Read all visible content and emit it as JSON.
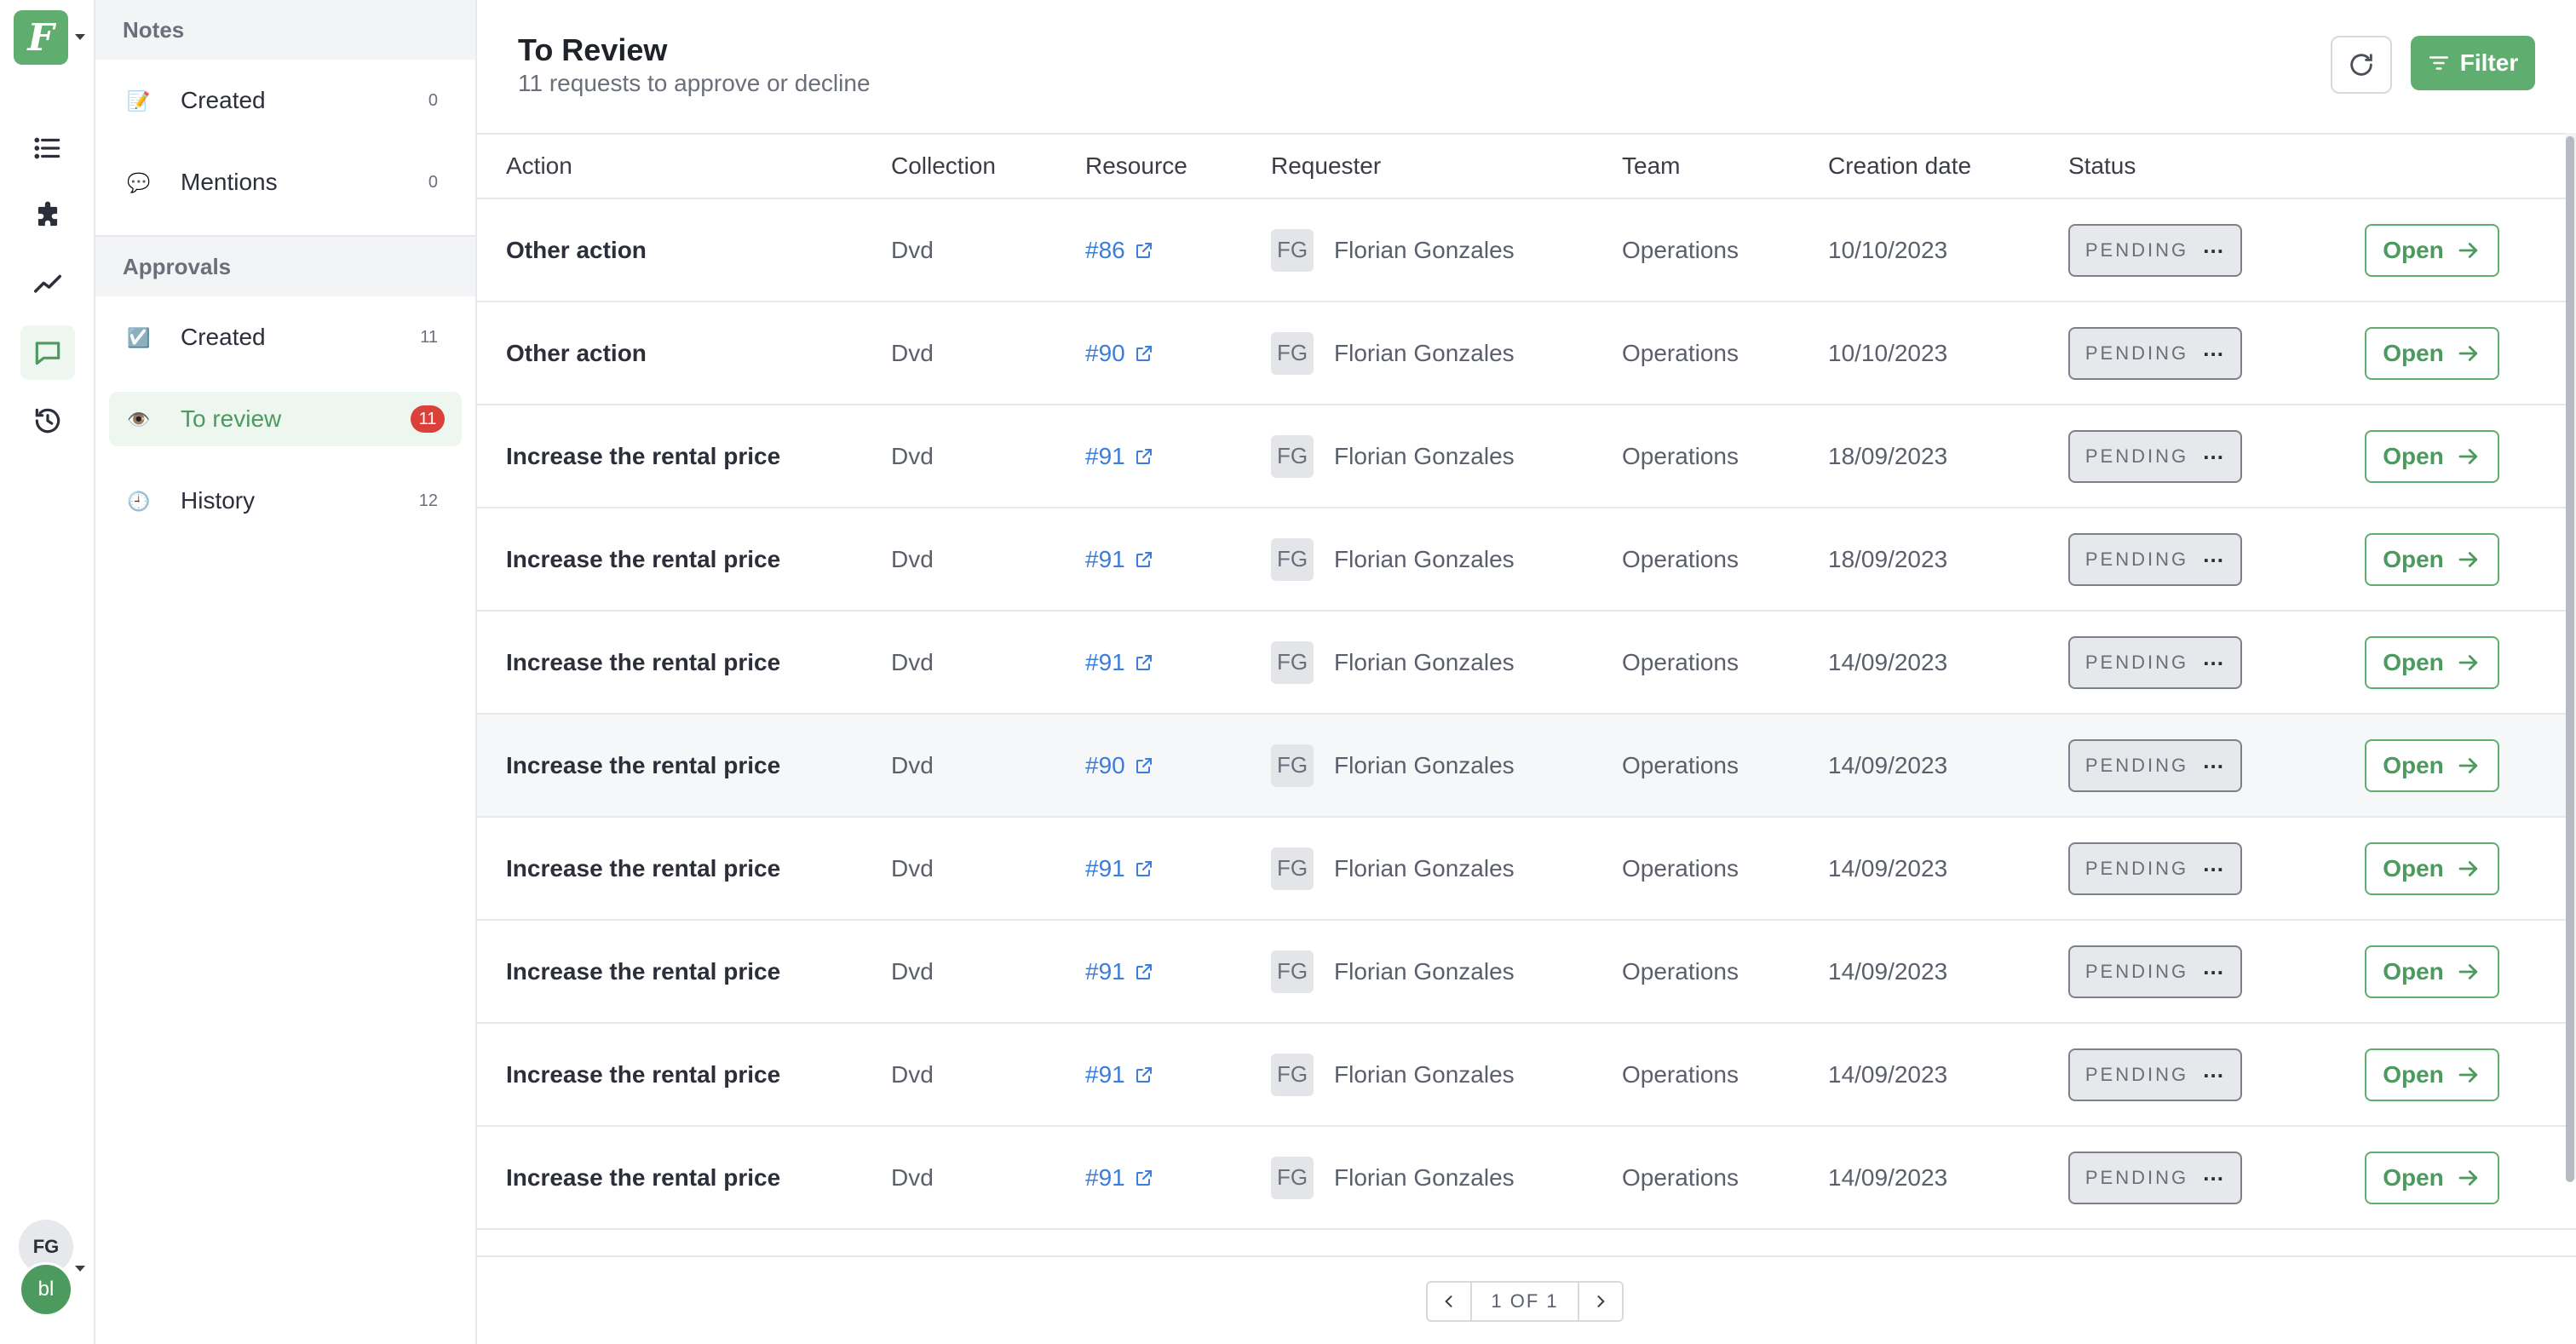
{
  "rail": {
    "logo_letter": "F",
    "avatar_initials": "FG",
    "workspace_initials": "bl",
    "icons": [
      "list-icon",
      "puzzle-icon",
      "chart-line-icon",
      "chat-icon",
      "history-icon"
    ]
  },
  "sidebar": {
    "notes_header": "Notes",
    "notes_items": [
      {
        "label": "Created",
        "count": "0"
      },
      {
        "label": "Mentions",
        "count": "0"
      }
    ],
    "approvals_header": "Approvals",
    "approval_items": [
      {
        "label": "Created",
        "count": "11"
      },
      {
        "label": "To review",
        "count": "11"
      },
      {
        "label": "History",
        "count": "12"
      }
    ]
  },
  "header": {
    "title": "To Review",
    "subtitle": "11 requests to approve or decline",
    "filter_label": "Filter"
  },
  "table": {
    "columns": [
      "Action",
      "Collection",
      "Resource",
      "Requester",
      "Team",
      "Creation date",
      "Status"
    ],
    "rows": [
      {
        "action": "Other action",
        "collection": "Dvd",
        "resource": "#86",
        "initials": "FG",
        "requester": "Florian Gonzales",
        "team": "Operations",
        "date": "10/10/2023",
        "status": "PENDING",
        "open": "Open"
      },
      {
        "action": "Other action",
        "collection": "Dvd",
        "resource": "#90",
        "initials": "FG",
        "requester": "Florian Gonzales",
        "team": "Operations",
        "date": "10/10/2023",
        "status": "PENDING",
        "open": "Open"
      },
      {
        "action": "Increase the rental price",
        "collection": "Dvd",
        "resource": "#91",
        "initials": "FG",
        "requester": "Florian Gonzales",
        "team": "Operations",
        "date": "18/09/2023",
        "status": "PENDING",
        "open": "Open"
      },
      {
        "action": "Increase the rental price",
        "collection": "Dvd",
        "resource": "#91",
        "initials": "FG",
        "requester": "Florian Gonzales",
        "team": "Operations",
        "date": "18/09/2023",
        "status": "PENDING",
        "open": "Open"
      },
      {
        "action": "Increase the rental price",
        "collection": "Dvd",
        "resource": "#91",
        "initials": "FG",
        "requester": "Florian Gonzales",
        "team": "Operations",
        "date": "14/09/2023",
        "status": "PENDING",
        "open": "Open"
      },
      {
        "action": "Increase the rental price",
        "collection": "Dvd",
        "resource": "#90",
        "initials": "FG",
        "requester": "Florian Gonzales",
        "team": "Operations",
        "date": "14/09/2023",
        "status": "PENDING",
        "open": "Open"
      },
      {
        "action": "Increase the rental price",
        "collection": "Dvd",
        "resource": "#91",
        "initials": "FG",
        "requester": "Florian Gonzales",
        "team": "Operations",
        "date": "14/09/2023",
        "status": "PENDING",
        "open": "Open"
      },
      {
        "action": "Increase the rental price",
        "collection": "Dvd",
        "resource": "#91",
        "initials": "FG",
        "requester": "Florian Gonzales",
        "team": "Operations",
        "date": "14/09/2023",
        "status": "PENDING",
        "open": "Open"
      },
      {
        "action": "Increase the rental price",
        "collection": "Dvd",
        "resource": "#91",
        "initials": "FG",
        "requester": "Florian Gonzales",
        "team": "Operations",
        "date": "14/09/2023",
        "status": "PENDING",
        "open": "Open"
      },
      {
        "action": "Increase the rental price",
        "collection": "Dvd",
        "resource": "#91",
        "initials": "FG",
        "requester": "Florian Gonzales",
        "team": "Operations",
        "date": "14/09/2023",
        "status": "PENDING",
        "open": "Open"
      }
    ]
  },
  "pagination": {
    "label": "1 OF 1"
  },
  "colors": {
    "brand_green": "#5fae6f",
    "link_blue": "#3b7ddd",
    "badge_red": "#d9413a"
  }
}
